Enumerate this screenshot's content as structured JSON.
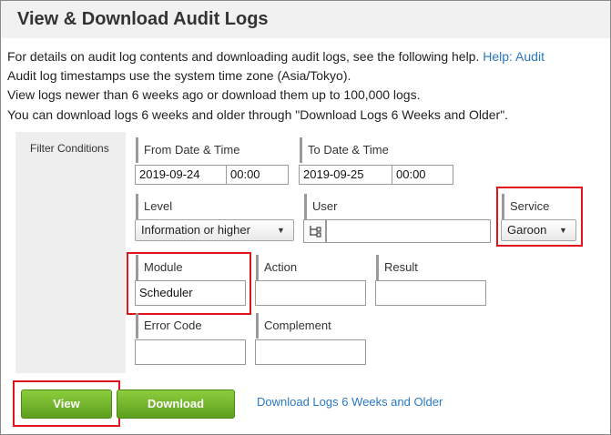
{
  "page": {
    "title": "View & Download Audit Logs"
  },
  "info": {
    "line1_prefix": "For details on audit log contents and downloading audit logs, see the following help.",
    "help_link": "Help: Audit",
    "line2": "Audit log timestamps use the system time zone (Asia/Tokyo).",
    "line3": "View logs newer than 6 weeks ago or download them up to 100,000 logs.",
    "line4": "You can download logs 6 weeks and older through \"Download Logs 6 Weeks and Older\"."
  },
  "filter": {
    "section_label": "Filter Conditions",
    "from_label": "From Date & Time",
    "from_date": "2019-09-24",
    "from_time": "00:00",
    "to_label": "To Date & Time",
    "to_date": "2019-09-25",
    "to_time": "00:00",
    "level_label": "Level",
    "level_value": "Information or higher",
    "user_label": "User",
    "user_value": "",
    "service_label": "Service",
    "service_value": "Garoon",
    "module_label": "Module",
    "module_value": "Scheduler",
    "action_label": "Action",
    "action_value": "",
    "result_label": "Result",
    "result_value": "",
    "error_code_label": "Error Code",
    "error_code_value": "",
    "complement_label": "Complement",
    "complement_value": ""
  },
  "actions": {
    "view_label": "View",
    "download_label": "Download",
    "old_logs_link": "Download Logs 6 Weeks and Older"
  },
  "icons": {
    "dropdown": "triangle-down-icon",
    "user_picker": "org-tree-icon"
  },
  "colors": {
    "highlight": "#e0141a",
    "button_green": "#6fb02a",
    "link": "#2a78c2"
  }
}
